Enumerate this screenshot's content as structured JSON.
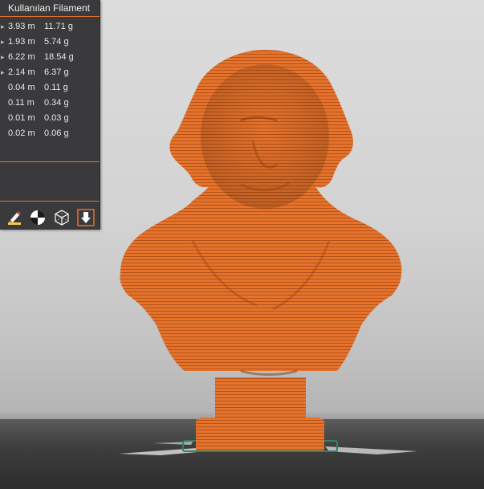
{
  "panel": {
    "title": "Kullanılan Filament",
    "rows": [
      {
        "length": "3.93 m",
        "weight": "11.71 g"
      },
      {
        "length": "1.93 m",
        "weight": "5.74 g"
      },
      {
        "length": "6.22 m",
        "weight": "18.54 g"
      },
      {
        "length": "2.14 m",
        "weight": "6.37 g"
      },
      {
        "length": "0.04 m",
        "weight": "0.11 g"
      },
      {
        "length": "0.11 m",
        "weight": "0.34 g"
      },
      {
        "length": "0.01 m",
        "weight": "0.03 g"
      },
      {
        "length": "0.02 m",
        "weight": "0.06 g"
      }
    ],
    "tool_icons": [
      "paint-brush-icon",
      "center-of-mass-icon",
      "wireframe-cube-icon",
      "export-down-icon"
    ]
  },
  "viewport": {
    "model": "sliced-bust",
    "colors": {
      "model": "#e5732b",
      "model_shade": "#b9541a",
      "bed": "#3a3a3a",
      "outline": "#2f8c6e",
      "accent": "#e5732b"
    }
  }
}
